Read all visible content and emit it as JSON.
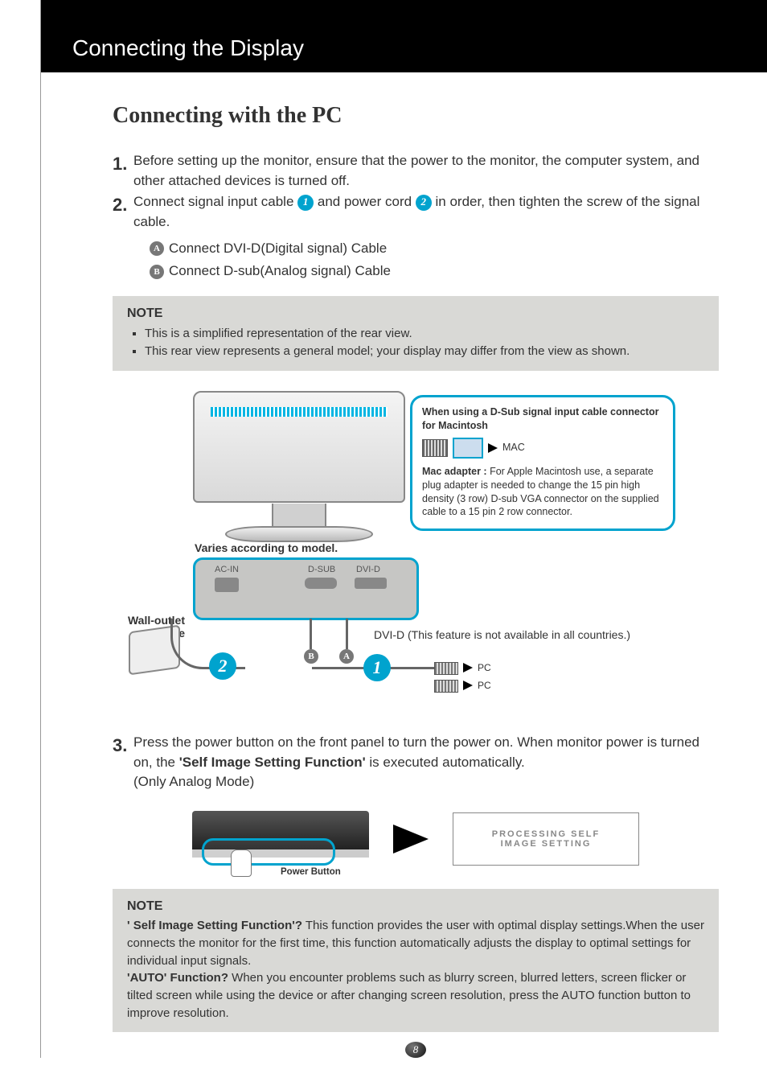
{
  "header": {
    "title": "Connecting the Display"
  },
  "section": {
    "heading": "Connecting with the PC"
  },
  "steps": {
    "s1": {
      "num": "1.",
      "text": "Before setting up the monitor, ensure that the power to the monitor, the computer system, and other attached devices is turned off."
    },
    "s2": {
      "num": "2.",
      "text_a": "Connect signal input cable ",
      "text_b": " and power cord ",
      "text_c": " in order, then tighten the screw of the signal cable.",
      "badge1": "1",
      "badge2": "2",
      "subA": {
        "badge": "A",
        "text": "Connect DVI-D(Digital signal) Cable"
      },
      "subB": {
        "badge": "B",
        "text": "Connect D-sub(Analog signal) Cable"
      }
    },
    "s3": {
      "num": "3.",
      "text_a": "Press the power button on the front panel to turn the power on. When monitor power is turned on, the ",
      "bold": "'Self Image Setting Function'",
      "text_b": " is executed automatically.",
      "text_c": "(Only Analog Mode)"
    }
  },
  "note1": {
    "title": "NOTE",
    "items": [
      "This is a simplified representation of the rear view.",
      "This rear view represents a general model; your display may differ from the view as shown."
    ]
  },
  "diagram": {
    "varies": "Varies according to model.",
    "wall": "Wall-outlet type",
    "ports": {
      "acin": "AC-IN",
      "dsub": "D-SUB",
      "dvid": "DVI-D"
    },
    "dvi_note": "DVI-D (This feature is not available in all countries.)",
    "pc": "PC",
    "badges": {
      "b1": "1",
      "b2": "2",
      "bA": "A",
      "bB": "B"
    },
    "mac": {
      "title": "When using a D-Sub signal input cable connector for Macintosh",
      "mac_label": "MAC",
      "adapter_lead": "Mac adapter : ",
      "adapter_text": "For Apple Macintosh use, a separate plug adapter is needed to change the 15 pin high density (3 row) D-sub VGA connector on the supplied cable to a 15 pin  2 row connector."
    }
  },
  "power_diagram": {
    "power_button": "Power Button",
    "osd_line1": "PROCESSING SELF",
    "osd_line2": "IMAGE SETTING"
  },
  "note2": {
    "title": "NOTE",
    "q1_lead": "' Self Image Setting Function'?",
    "q1_text": " This function provides the user with optimal display settings.When the user connects the monitor for the first time, this function automatically adjusts the display to optimal settings for individual input signals.",
    "q2_lead": "'AUTO' Function?",
    "q2_text": " When you encounter problems such as blurry screen, blurred letters, screen flicker or tilted screen while using the device or after changing screen resolution, press the AUTO function button to improve resolution."
  },
  "page_number": "8"
}
